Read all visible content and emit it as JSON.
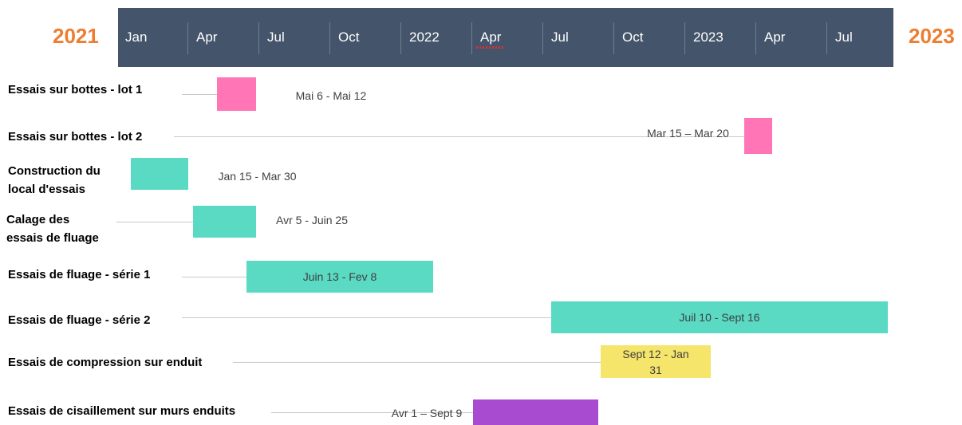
{
  "chart_data": {
    "type": "gantt",
    "start_year_label": "2021",
    "end_year_label": "2023",
    "axis_ticks": [
      "Jan",
      "Apr",
      "Jul",
      "Oct",
      "2022",
      "Apr",
      "Jul",
      "Oct",
      "2023",
      "Apr",
      "Jul"
    ],
    "header_color": "#44546A",
    "year_label_color": "#ED7D31",
    "tasks": [
      {
        "label": "Essais sur bottes - lot 1",
        "start": "2021-05-06",
        "end": "2021-06-25",
        "date_label": "Mai 6   - Mai 12",
        "color": "#FF75B5"
      },
      {
        "label": "Essais sur bottes - lot 2",
        "start": "2023-03-15",
        "end": "2023-04-20",
        "date_label": "Mar 15 – Mar 20",
        "color": "#FF75B5"
      },
      {
        "label": "Construction du\nlocal d'essais",
        "start": "2021-01-15",
        "end": "2021-03-30",
        "date_label": "Jan 15 - Mar 30",
        "color": "#5AD9C3"
      },
      {
        "label": "Calage des\nessais de fluage",
        "start": "2021-04-05",
        "end": "2021-06-25",
        "date_label": "Avr 5 - Juin 25",
        "color": "#5AD9C3"
      },
      {
        "label": "Essais de fluage - série 1",
        "start": "2021-06-13",
        "end": "2022-02-08",
        "date_label": "Juin 13 - Fev 8",
        "color": "#5AD9C3"
      },
      {
        "label": "Essais de fluage - série 2",
        "start": "2022-07-10",
        "end": "2023-09-16",
        "date_label": "Juil 10 - Sept 16",
        "color": "#5AD9C3"
      },
      {
        "label": "Essais de compression sur enduit",
        "start": "2022-09-12",
        "end": "2023-01-31",
        "date_label": "Sept 12 - Jan\n31",
        "color": "#F5E56B"
      },
      {
        "label": "Essais de cisaillement sur murs enduits",
        "start": "2022-04-01",
        "end": "2022-09-09",
        "date_label": "Avr 1 – Sept 9",
        "color": "#A94BD0"
      }
    ]
  }
}
